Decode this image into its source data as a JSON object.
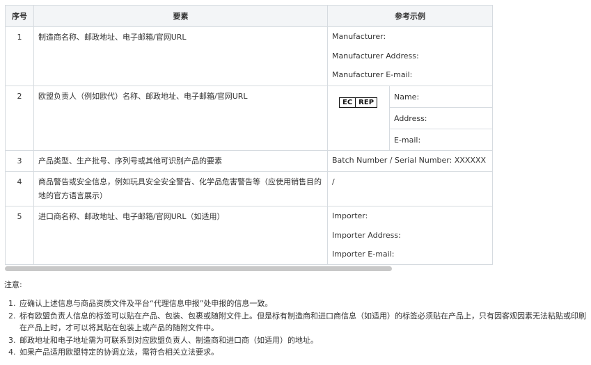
{
  "table": {
    "headers": [
      "序号",
      "要素",
      "参考示例"
    ],
    "rows": [
      {
        "no": "1",
        "element": "制造商名称、邮政地址、电子邮箱/官网URL",
        "examples": [
          "Manufacturer:",
          "Manufacturer Address:",
          "Manufacturer E-mail:"
        ]
      },
      {
        "no": "2",
        "element": "欧盟负责人（例如欧代）名称、邮政地址、电子邮箱/官网URL",
        "logo": {
          "left": "EC",
          "right": "REP"
        },
        "examples": [
          "Name:",
          "Address:",
          "E-mail:"
        ]
      },
      {
        "no": "3",
        "element": "产品类型、生产批号、序列号或其他可识别产品的要素",
        "examples": [
          "Batch Number / Serial Number: XXXXXX"
        ]
      },
      {
        "no": "4",
        "element": "商品警告或安全信息，例如玩具安全安全警告、化学品危害警告等（应使用销售目的地的官方语言展示）",
        "examples": [
          "/"
        ]
      },
      {
        "no": "5",
        "element": "进口商名称、邮政地址、电子邮箱/官网URL（如适用）",
        "examples": [
          "Importer:",
          "Importer Address:",
          "Importer E-mail:"
        ]
      }
    ]
  },
  "notes": {
    "title": "注意:",
    "items": [
      "应确认上述信息与商品资质文件及平台“代理信息申报”处申报的信息一致。",
      "标有欧盟负责人信息的标签可以贴在产品、包装、包裹或随附文件上。但是标有制造商和进口商信息（如适用）的标签必须贴在产品上，只有因客观因素无法粘贴或印刷在产品上时，才可以将其贴在包装上或产品的随附文件中。",
      "邮政地址和电子地址需为可联系到对应欧盟负责人、制造商和进口商（如适用）的地址。",
      "如果产品适用欧盟特定的协调立法，需符合相关立法要求。"
    ]
  }
}
